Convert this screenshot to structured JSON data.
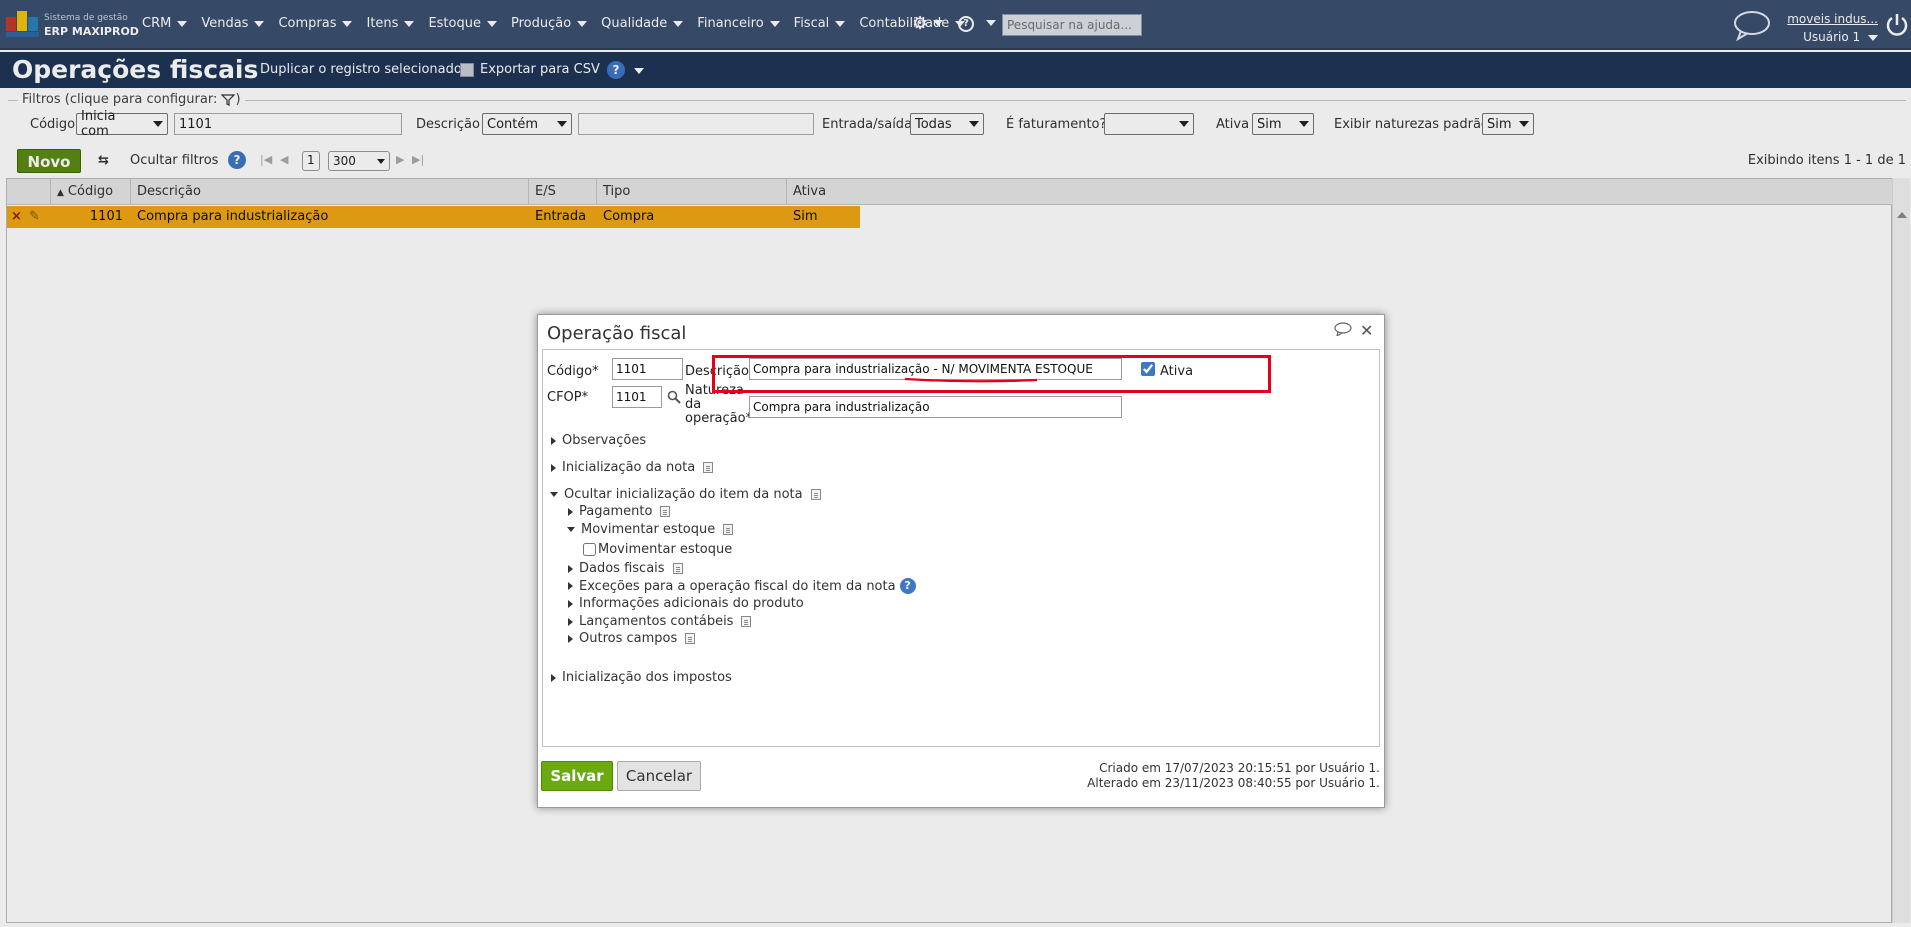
{
  "app": {
    "brand_line1": "Sistema de gestão",
    "brand_line2": "ERP MAXIPROD",
    "menu": [
      "CRM",
      "Vendas",
      "Compras",
      "Itens",
      "Estoque",
      "Produção",
      "Qualidade",
      "Financeiro",
      "Fiscal",
      "Contabilidade"
    ],
    "search_placeholder": "Pesquisar na ajuda...",
    "company": "moveis indus...",
    "user": "Usuário 1"
  },
  "page": {
    "title": "Operações fiscais",
    "duplicate": "Duplicar o registro selecionado",
    "export": "Exportar para CSV"
  },
  "filters": {
    "legend": "Filtros (clique para configurar:",
    "codigo_label": "Código",
    "codigo_op": "Inicia com",
    "codigo_value": "1101",
    "descricao_label": "Descrição",
    "descricao_op": "Contém",
    "descricao_value": "",
    "entrada_label": "Entrada/saída",
    "entrada_value": "Todas",
    "faturamento_label": "É faturamento?",
    "faturamento_value": "",
    "ativa_label": "Ativa",
    "ativa_value": "Sim",
    "naturezas_label": "Exibir naturezas padrão",
    "naturezas_value": "Sim"
  },
  "toolbar": {
    "new": "Novo",
    "hide_filters": "Ocultar filtros",
    "page": "1",
    "page_size": "300",
    "info": "Exibindo itens 1 - 1 de 1"
  },
  "grid": {
    "columns": [
      "Código",
      "Descrição",
      "E/S",
      "Tipo",
      "Ativa"
    ],
    "rows": [
      {
        "codigo": "1101",
        "descricao": "Compra para industrialização",
        "es": "Entrada",
        "tipo": "Compra",
        "ativa": "Sim"
      }
    ]
  },
  "modal": {
    "title": "Operação fiscal",
    "codigo_label": "Código*",
    "codigo_value": "1101",
    "cfop_label": "CFOP*",
    "cfop_value": "1101",
    "descricao_label": "Descrição*",
    "descricao_value": "Compra para industrialização - N/ MOVIMENTA ESTOQUE",
    "ativa_label": "Ativa",
    "natureza_label": [
      "Natureza",
      "da",
      "operação*"
    ],
    "natureza_value": "Compra para industrialização",
    "sections": {
      "observacoes": "Observações",
      "inicializacao_nota": "Inicialização da nota",
      "ocultar_item": "Ocultar inicialização do item da nota",
      "pagamento": "Pagamento",
      "movimentar": "Movimentar estoque",
      "movimentar_check": "Movimentar estoque",
      "dados_fiscais": "Dados fiscais",
      "excecoes": "Exceções para a operação fiscal do item da nota",
      "info_adicionais": "Informações adicionais do produto",
      "lancamentos": "Lançamentos contábeis",
      "outros": "Outros campos",
      "impostos": "Inicialização dos impostos"
    },
    "save": "Salvar",
    "cancel": "Cancelar",
    "created": "Criado em 17/07/2023 20:15:51 por Usuário 1.",
    "modified": "Alterado em 23/11/2023 08:40:55 por Usuário 1."
  },
  "colors": {
    "nav": "#3b5070",
    "header": "#1f3556",
    "selected_row": "#f0a614",
    "save": "#6aaa10",
    "highlight": "#e4001b"
  }
}
